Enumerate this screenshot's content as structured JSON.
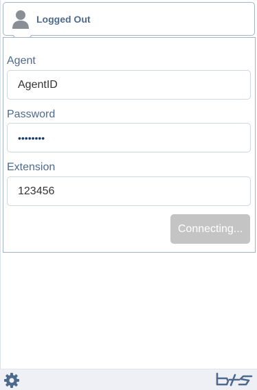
{
  "header": {
    "status": "Logged Out",
    "icon": "user-icon"
  },
  "form": {
    "agent": {
      "label": "Agent",
      "value": "AgentID"
    },
    "password": {
      "label": "Password",
      "value": "••••••••"
    },
    "extension": {
      "label": "Extension",
      "value": "123456"
    },
    "connect_button": "Connecting..."
  },
  "footer": {
    "settings_icon": "gear-icon",
    "logo_icon": "bluecube-logo-icon"
  },
  "colors": {
    "accent": "#4d6a8d",
    "border": "#9fb3c8",
    "button_disabled": "#c4c4c4",
    "footer_bg": "#eef0f5",
    "icon": "#4d6a8d"
  }
}
